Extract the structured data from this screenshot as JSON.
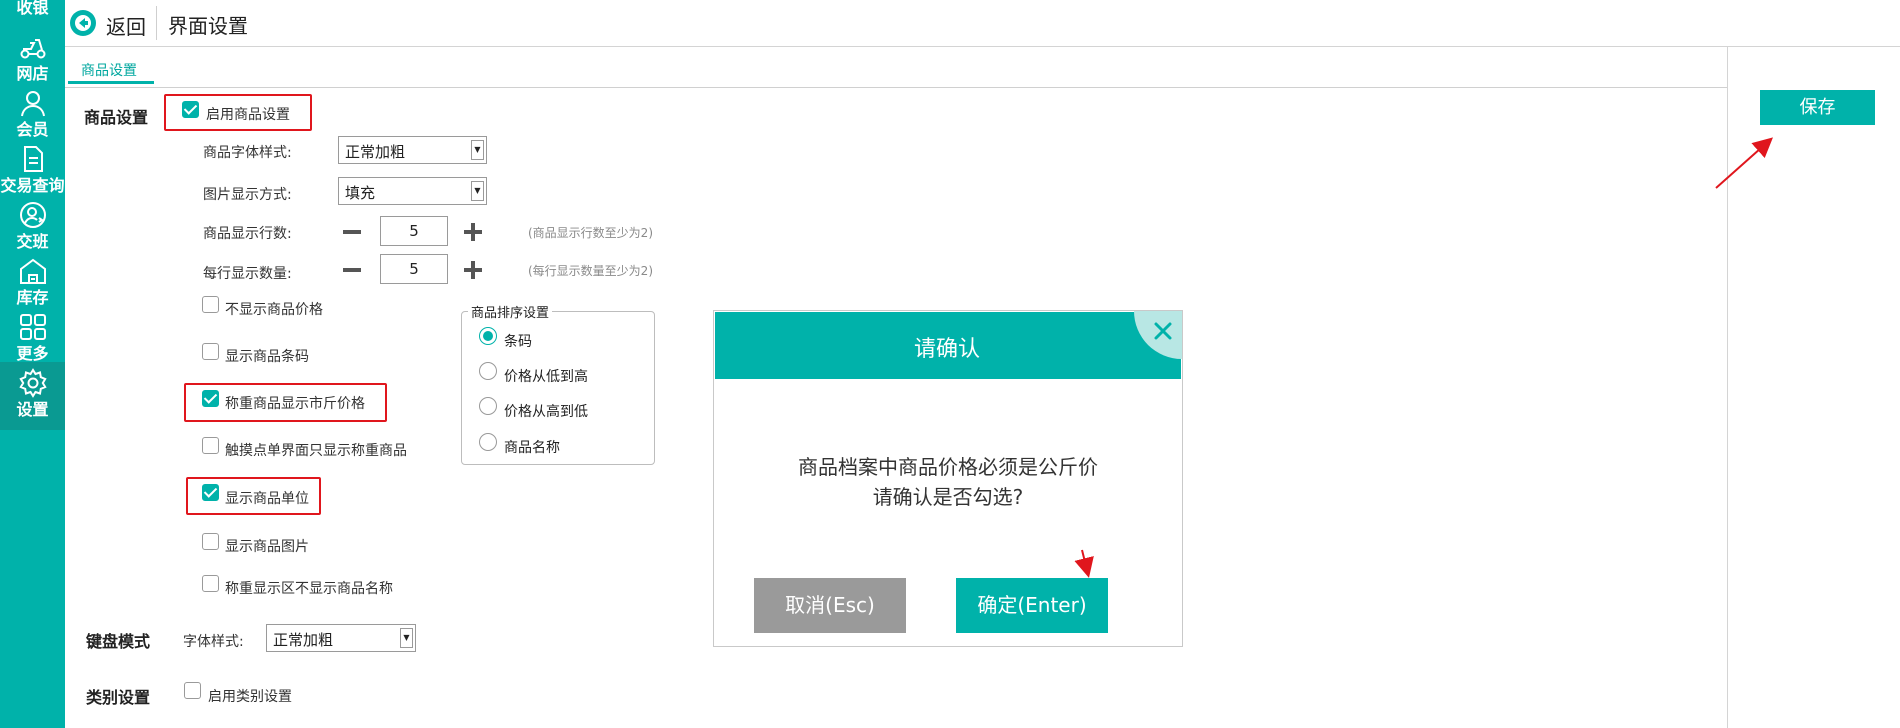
{
  "sidebar": {
    "items": [
      {
        "label": "收银",
        "icon": "cashier-icon"
      },
      {
        "label": "网店",
        "icon": "scooter-icon"
      },
      {
        "label": "会员",
        "icon": "person-icon"
      },
      {
        "label": "交易查询",
        "icon": "document-icon"
      },
      {
        "label": "交班",
        "icon": "shift-user-icon"
      },
      {
        "label": "库存",
        "icon": "warehouse-icon"
      },
      {
        "label": "更多",
        "icon": "grid-icon"
      },
      {
        "label": "设置",
        "icon": "gear-icon"
      }
    ],
    "active": "设置"
  },
  "header": {
    "back_label": "返回",
    "title": "界面设置"
  },
  "tabs": [
    {
      "label": "商品设置",
      "active": true
    }
  ],
  "save_label": "保存",
  "goods": {
    "section_label": "商品设置",
    "enable": {
      "label": "启用商品设置",
      "checked": true
    },
    "font_style": {
      "label": "商品字体样式:",
      "value": "正常加粗"
    },
    "image_mode": {
      "label": "图片显示方式:",
      "value": "填充"
    },
    "rows": {
      "label": "商品显示行数:",
      "value": "5",
      "hint": "(商品显示行数至少为2)"
    },
    "per_row": {
      "label": "每行显示数量:",
      "value": "5",
      "hint": "(每行显示数量至少为2)"
    },
    "options": [
      {
        "label": "不显示商品价格",
        "checked": false
      },
      {
        "label": "显示商品条码",
        "checked": false
      },
      {
        "label": "称重商品显示市斤价格",
        "checked": true
      },
      {
        "label": "触摸点单界面只显示称重商品",
        "checked": false
      },
      {
        "label": "显示商品单位",
        "checked": true
      },
      {
        "label": "显示商品图片",
        "checked": false
      },
      {
        "label": "称重显示区不显示商品名称",
        "checked": false
      }
    ]
  },
  "sort": {
    "title": "商品排序设置",
    "options": [
      {
        "label": "条码",
        "selected": true
      },
      {
        "label": "价格从低到高",
        "selected": false
      },
      {
        "label": "价格从高到低",
        "selected": false
      },
      {
        "label": "商品名称",
        "selected": false
      }
    ]
  },
  "keyboard": {
    "section_label": "键盘模式",
    "font_label": "字体样式:",
    "font_value": "正常加粗"
  },
  "category": {
    "section_label": "类别设置",
    "enable_label": "启用类别设置",
    "checked": false
  },
  "dialog": {
    "title": "请确认",
    "message_line1": "商品档案中商品价格必须是公斤价",
    "message_line2": "请确认是否勾选?",
    "cancel_label": "取消(Esc)",
    "ok_label": "确定(Enter)"
  },
  "colors": {
    "brand": "#00b2aa",
    "annotation": "#e0161d"
  }
}
